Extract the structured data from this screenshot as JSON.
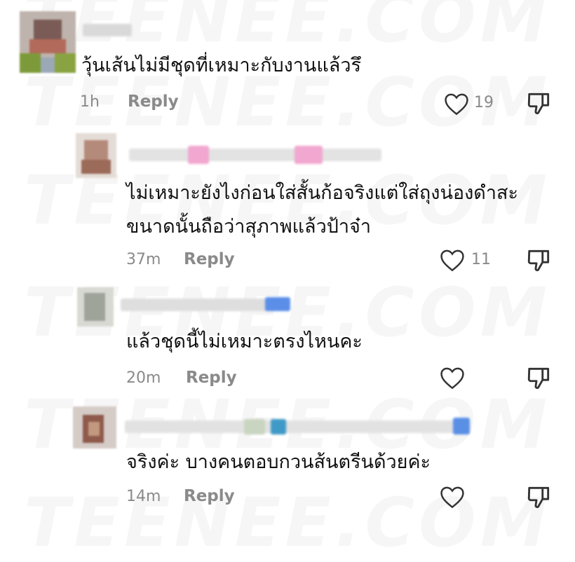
{
  "watermark": "TEENEE.COM",
  "colors": {
    "meta": "#8a8a8a",
    "text": "#111111",
    "icon": "#333333"
  },
  "comments": [
    {
      "text_lines": [
        "วุ้นเส้นไม่มีชุดที่เหมาะกับงานแล้วรึ"
      ],
      "time": "1h",
      "reply_label": "Reply",
      "likes": "19",
      "like_icon": "heart-outline-icon",
      "dislike_icon": "thumbs-down-icon"
    },
    {
      "text_lines": [
        "ไม่เหมาะยังไงก่อนใส่สั้นก้อจริงแต่ใส่ถุงน่องดำสะ",
        "ขนาดนั้นถือว่าสุภาพแล้วป้าจ๋า"
      ],
      "time": "37m",
      "reply_label": "Reply",
      "likes": "11",
      "like_icon": "heart-outline-icon",
      "dislike_icon": "thumbs-down-icon"
    },
    {
      "text_lines": [
        "แล้วชุดนี้ไม่เหมาะตรงไหนคะ"
      ],
      "time": "20m",
      "reply_label": "Reply",
      "likes": "",
      "like_icon": "heart-outline-icon",
      "dislike_icon": "thumbs-down-icon"
    },
    {
      "text_lines": [
        "จริงค่ะ บางคนตอบกวนส้นตรีนด้วยค่ะ"
      ],
      "time": "14m",
      "reply_label": "Reply",
      "likes": "",
      "like_icon": "heart-outline-icon",
      "dislike_icon": "thumbs-down-icon"
    }
  ]
}
